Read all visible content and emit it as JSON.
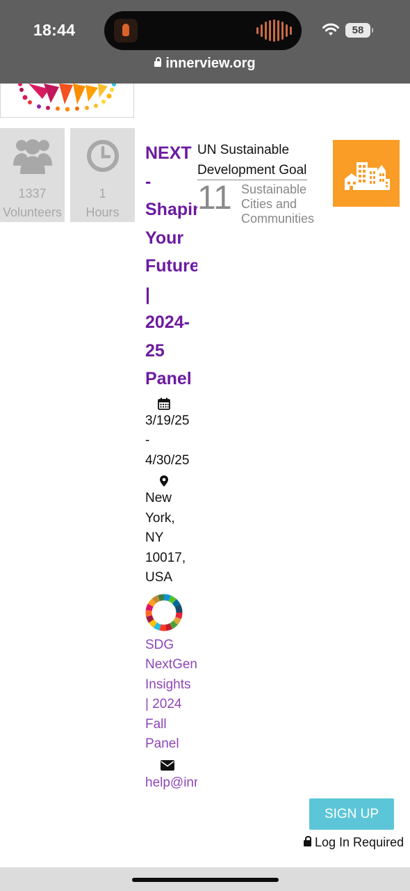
{
  "status_bar": {
    "time": "18:44",
    "battery": "58"
  },
  "address_bar": {
    "url": "innerview.org"
  },
  "stats": [
    {
      "value": "1337",
      "label": "Volunteers",
      "icon": "users-icon"
    },
    {
      "value": "1",
      "label": "Hours",
      "icon": "clock-icon"
    }
  ],
  "event": {
    "title": "NEXT\n-\nShapir\nYour\nFuture\n|\n2024-\n25\nPanel",
    "date_icon": "calendar-icon",
    "dates": "3/19/25\n-\n4/30/25",
    "location_icon": "map-pin-icon",
    "location": "New\nYork,\nNY\n10017,\nUSA",
    "org_logo": "sdg-wheel-logo",
    "organization": "SDG\nNextGen\nInsights\n| 2024\nFall\nPanel",
    "email_icon": "envelope-icon",
    "email": "help@inr"
  },
  "sdg": {
    "heading": "UN Sustainable\nDevelopment Goal",
    "number": "11",
    "name": "Sustainable\nCities and\nCommunities",
    "color": "#F99D26"
  },
  "actions": {
    "signup_label": "SIGN UP",
    "login_note": "Log In Required",
    "signup_color": "#5CC6D8"
  },
  "colors": {
    "title": "#6C1AA0",
    "link": "#8E46B8"
  }
}
